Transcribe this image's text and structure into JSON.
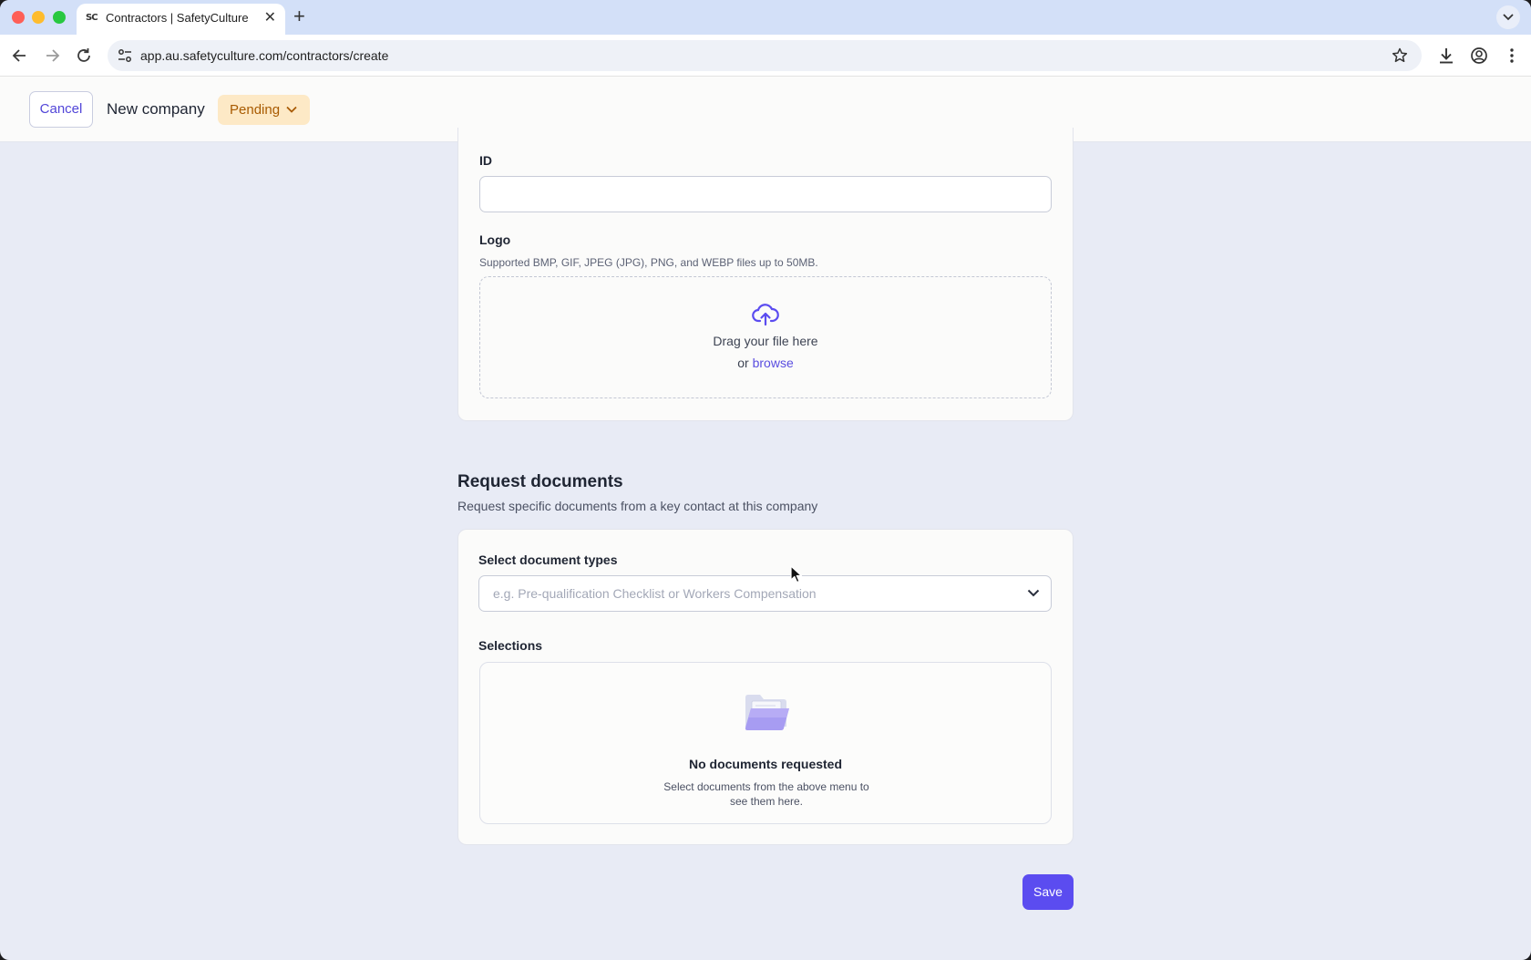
{
  "browser": {
    "tab_title": "Contractors | SafetyCulture",
    "tab_favicon": "SC",
    "url": "app.au.safetyculture.com/contractors/create"
  },
  "header": {
    "cancel_label": "Cancel",
    "title": "New company",
    "status_label": "Pending"
  },
  "form": {
    "id_label": "ID",
    "id_value": "",
    "logo_label": "Logo",
    "logo_hint": "Supported BMP, GIF, JPEG (JPG), PNG, and WEBP files up to 50MB.",
    "dropzone_text": "Drag your file here",
    "dropzone_or": "or",
    "dropzone_browse": "browse"
  },
  "request_documents": {
    "title": "Request documents",
    "subtitle": "Request specific documents from a key contact at this company",
    "select_label": "Select document types",
    "select_placeholder": "e.g. Pre-qualification Checklist or Workers Compensation",
    "selections_label": "Selections",
    "empty_title": "No documents requested",
    "empty_desc": "Select documents from the above menu to see them here."
  },
  "actions": {
    "save_label": "Save"
  },
  "icons": {
    "back": "arrow-left-icon",
    "forward": "arrow-right-icon",
    "reload": "reload-icon",
    "site_info": "tune-icon",
    "bookmark": "star-icon",
    "download": "download-icon",
    "profile": "profile-icon",
    "menu": "kebab-menu-icon",
    "upload": "cloud-upload-icon",
    "empty": "folder-icon"
  },
  "colors": {
    "accent": "#5b4cf0",
    "status_bg": "#fde9c6",
    "status_text": "#a85a00",
    "page_bg": "#e8ebf5"
  }
}
